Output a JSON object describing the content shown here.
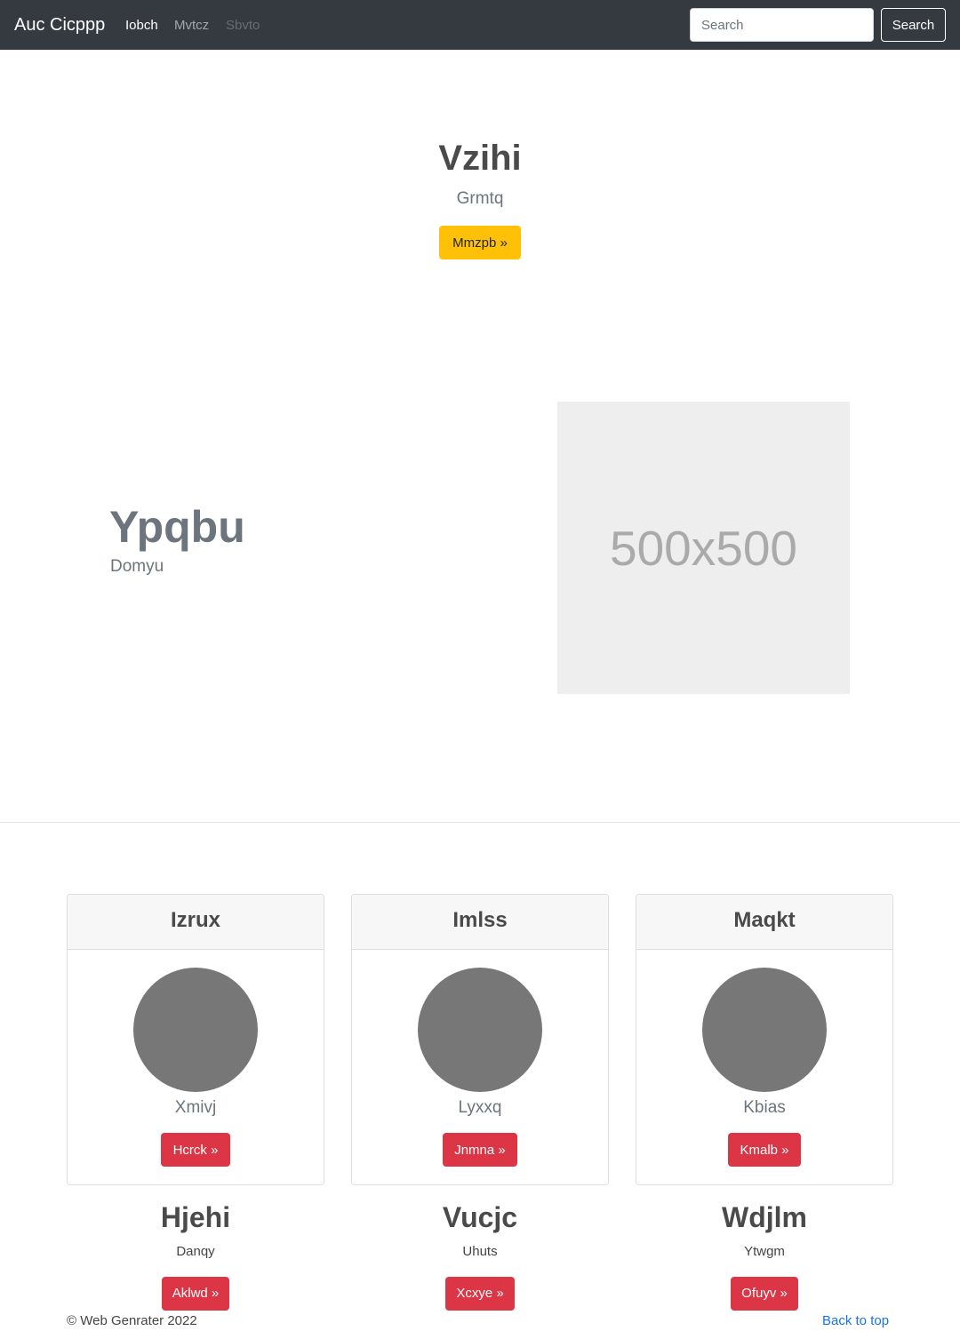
{
  "navbar": {
    "brand": "Auc Cicppp",
    "links": [
      "Iobch",
      "Mvtcz",
      "Sbvto"
    ],
    "search_placeholder": "Search",
    "search_button": "Search"
  },
  "hero": {
    "title": "Vzihi",
    "subtitle": "Grmtq",
    "button": "Mmzpb »"
  },
  "feature": {
    "title": "Ypqbu",
    "subtitle": "Domyu",
    "image_text": "500x500"
  },
  "cards": [
    {
      "header": "Izrux",
      "text": "Xmivj",
      "button": "Hcrck »"
    },
    {
      "header": "Imlss",
      "text": "Lyxxq",
      "button": "Jnmna »"
    },
    {
      "header": "Maqkt",
      "text": "Kbias",
      "button": "Kmalb »"
    }
  ],
  "columns": [
    {
      "title": "Hjehi",
      "text": "Danqy",
      "button": "Aklwd »"
    },
    {
      "title": "Vucjc",
      "text": "Uhuts",
      "button": "Xcxye »"
    },
    {
      "title": "Wdjlm",
      "text": "Ytwgm",
      "button": "Ofuyv »"
    }
  ],
  "footer": {
    "copyright": "© Web Genrater 2022",
    "back_to_top": "Back to top"
  },
  "colors": {
    "navbar_bg": "#343a40",
    "warning": "#ffc107",
    "danger": "#dc3545",
    "link": "#1a73e8"
  }
}
